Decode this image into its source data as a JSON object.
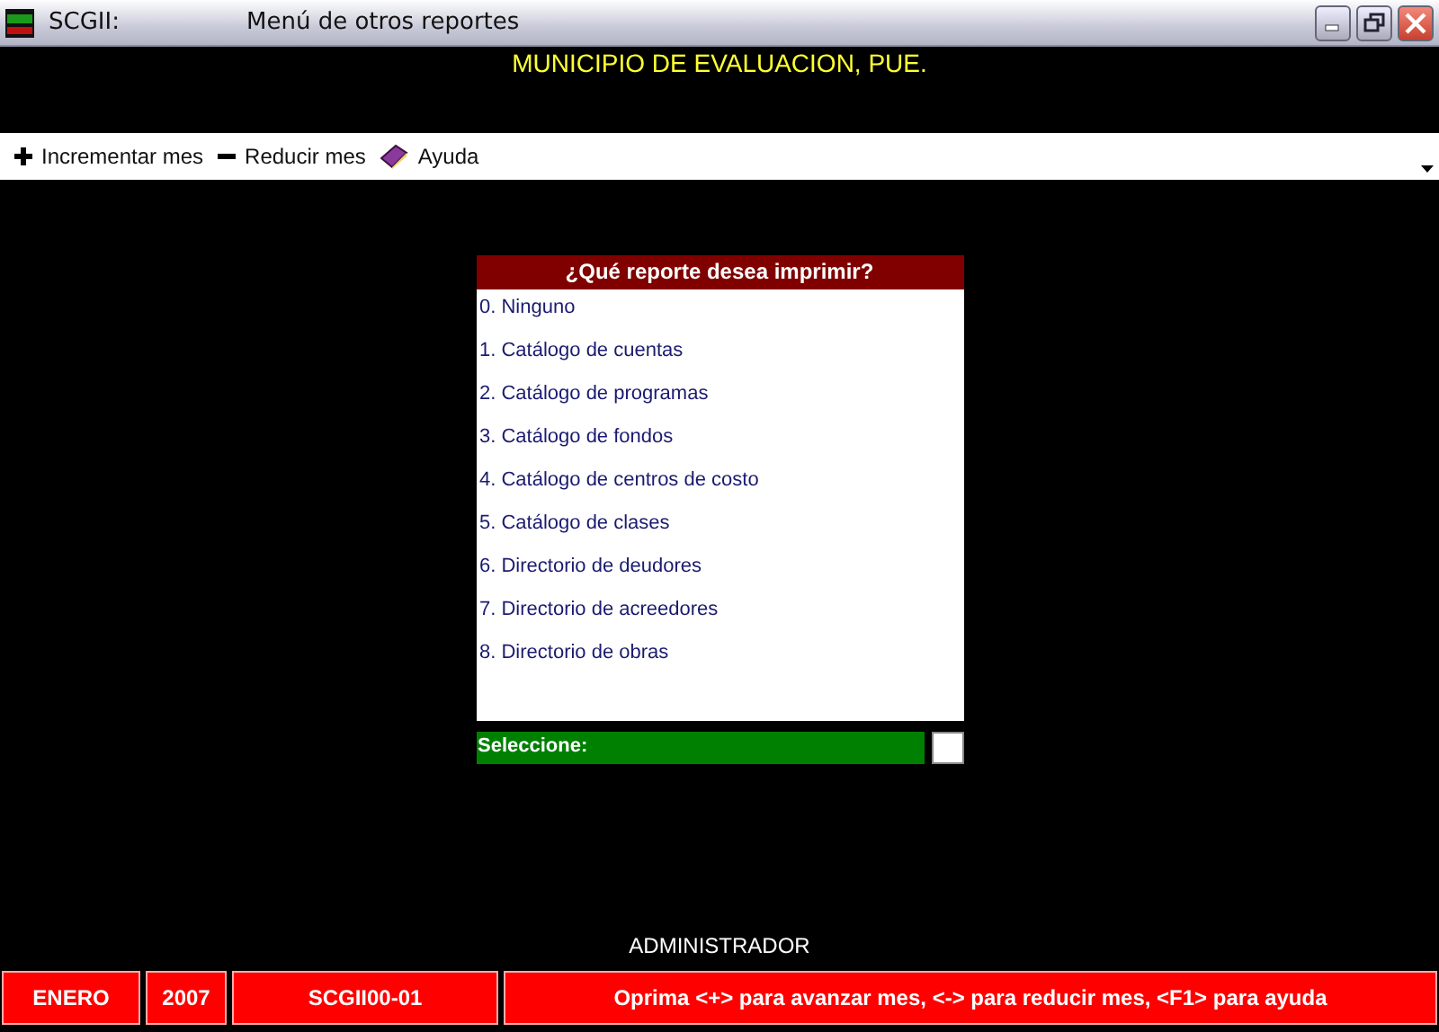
{
  "window": {
    "app": "SCGII:",
    "title": "Menú de otros reportes"
  },
  "header": "MUNICIPIO DE EVALUACION, PUE.",
  "toolbar": [
    {
      "kind": "plus",
      "label": "Incrementar mes"
    },
    {
      "kind": "minus",
      "label": "Reducir mes"
    },
    {
      "kind": "book",
      "label": "Ayuda"
    }
  ],
  "dialog": {
    "title": "¿Qué reporte desea imprimir?",
    "items": [
      "0. Ninguno",
      "1. Catálogo de cuentas",
      "2. Catálogo de programas",
      "3. Catálogo de fondos",
      "4. Catálogo de centros de costo",
      "5. Catálogo de clases",
      "6. Directorio de deudores",
      "7. Directorio de acreedores",
      "8. Directorio de obras"
    ],
    "prompt": "Seleccione:"
  },
  "user": "ADMINISTRADOR",
  "status_bar": [
    "ENERO",
    "2007",
    "SCGII00-01",
    "Oprima <+> para avanzar mes, <-> para reducir mes, <F1> para ayuda"
  ]
}
